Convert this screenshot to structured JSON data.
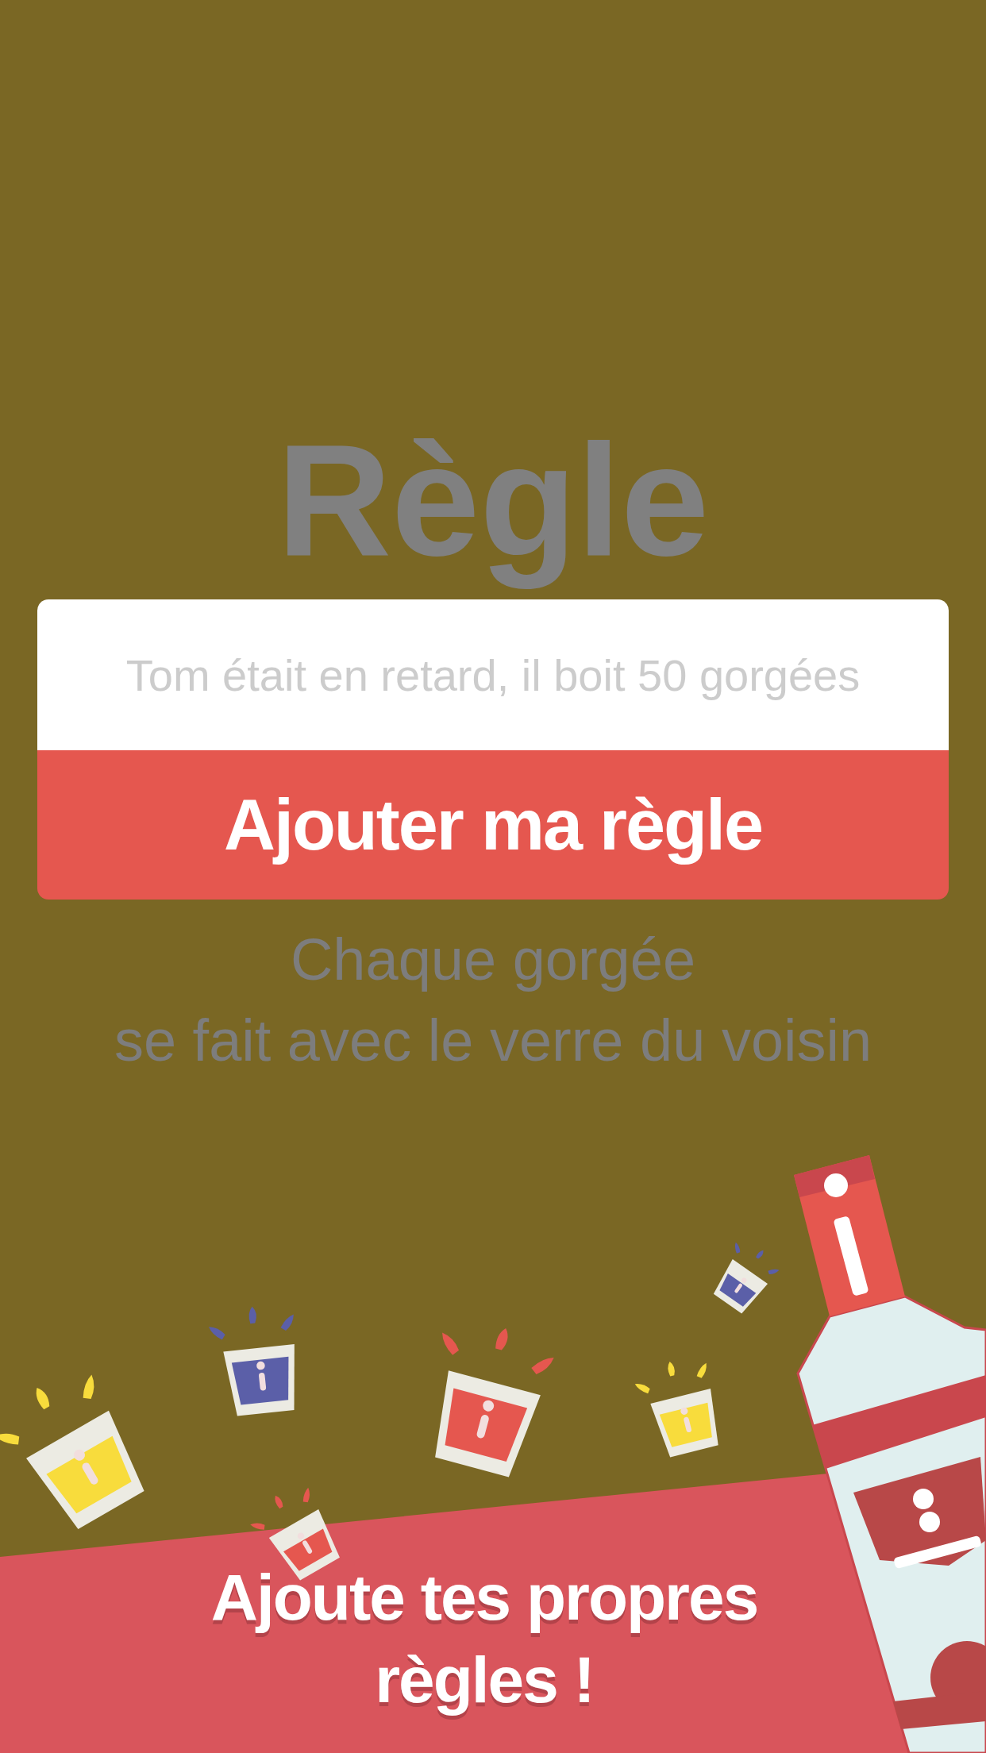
{
  "title": "Règle",
  "rule_field": {
    "placeholder": "Tom était en retard, il boit 50 gorgées"
  },
  "add_button": {
    "label": "Ajouter ma règle"
  },
  "hint_lines": [
    "Chaque gorgée",
    "se fait avec le verre du voisin"
  ],
  "banner": {
    "text": "Ajoute tes propres règles !"
  }
}
